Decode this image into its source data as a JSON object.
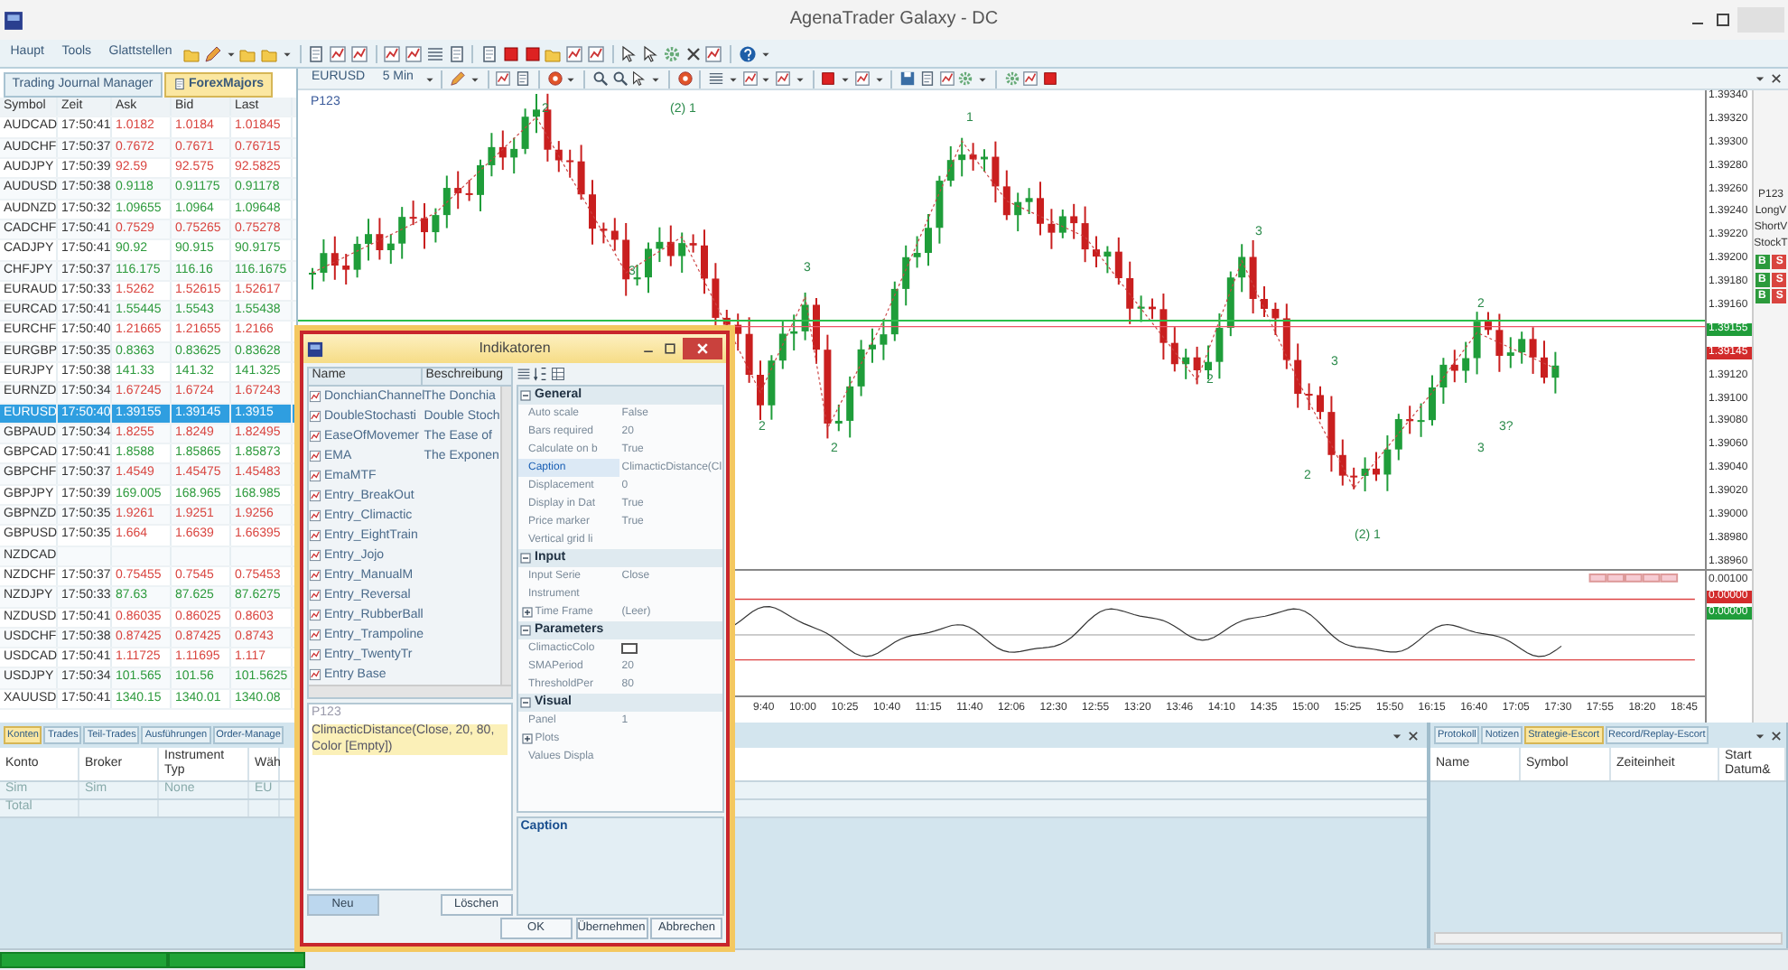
{
  "window": {
    "title": "AgenaTrader Galaxy - DC"
  },
  "menu": [
    {
      "label": "Haupt"
    },
    {
      "label": "Tools"
    },
    {
      "label": "Glattstellen"
    }
  ],
  "watchlist": {
    "tabs": [
      {
        "label": "Trading Journal Manager",
        "selected": false
      },
      {
        "label": "ForexMajors",
        "selected": true
      }
    ],
    "columns": [
      "Symbol",
      "Zeit",
      "Ask",
      "Bid",
      "Last"
    ],
    "rows": [
      {
        "symbol": "AUDCAD",
        "time": "17:50:41",
        "ask": "1.0182",
        "bid": "1.0184",
        "last": "1.01845",
        "color": "#d9443f",
        "selected": false
      },
      {
        "symbol": "AUDCHF",
        "time": "17:50:37",
        "ask": "0.7672",
        "bid": "0.7671",
        "last": "0.76715",
        "color": "#d9443f",
        "selected": false
      },
      {
        "symbol": "AUDJPY",
        "time": "17:50:39",
        "ask": "92.59",
        "bid": "92.575",
        "last": "92.5825",
        "color": "#d9443f",
        "selected": false
      },
      {
        "symbol": "AUDUSD",
        "time": "17:50:38",
        "ask": "0.9118",
        "bid": "0.91175",
        "last": "0.91178",
        "color": "#2c9a3c",
        "selected": false
      },
      {
        "symbol": "AUDNZD",
        "time": "17:50:32",
        "ask": "1.09655",
        "bid": "1.0964",
        "last": "1.09648",
        "color": "#2c9a3c",
        "selected": false
      },
      {
        "symbol": "CADCHF",
        "time": "17:50:41",
        "ask": "0.7529",
        "bid": "0.75265",
        "last": "0.75278",
        "color": "#d9443f",
        "selected": false
      },
      {
        "symbol": "CADJPY",
        "time": "17:50:41",
        "ask": "90.92",
        "bid": "90.915",
        "last": "90.9175",
        "color": "#2c9a3c",
        "selected": false
      },
      {
        "symbol": "CHFJPY",
        "time": "17:50:37",
        "ask": "116.175",
        "bid": "116.16",
        "last": "116.1675",
        "color": "#2c9a3c",
        "selected": false
      },
      {
        "symbol": "EURAUD",
        "time": "17:50:33",
        "ask": "1.5262",
        "bid": "1.52615",
        "last": "1.52617",
        "color": "#d9443f",
        "selected": false
      },
      {
        "symbol": "EURCAD",
        "time": "17:50:41",
        "ask": "1.55445",
        "bid": "1.5543",
        "last": "1.55438",
        "color": "#2c9a3c",
        "selected": false
      },
      {
        "symbol": "EURCHF",
        "time": "17:50:40",
        "ask": "1.21665",
        "bid": "1.21655",
        "last": "1.2166",
        "color": "#d9443f",
        "selected": false
      },
      {
        "symbol": "EURGBP",
        "time": "17:50:35",
        "ask": "0.8363",
        "bid": "0.83625",
        "last": "0.83628",
        "color": "#2c9a3c",
        "selected": false
      },
      {
        "symbol": "EURJPY",
        "time": "17:50:38",
        "ask": "141.33",
        "bid": "141.32",
        "last": "141.325",
        "color": "#2c9a3c",
        "selected": false
      },
      {
        "symbol": "EURNZD",
        "time": "17:50:34",
        "ask": "1.67245",
        "bid": "1.6724",
        "last": "1.67243",
        "color": "#d9443f",
        "selected": false
      },
      {
        "symbol": "EURUSD",
        "time": "17:50:40",
        "ask": "1.39155",
        "bid": "1.39145",
        "last": "1.3915",
        "selected": true
      },
      {
        "symbol": "GBPAUD",
        "time": "17:50:34",
        "ask": "1.8255",
        "bid": "1.8249",
        "last": "1.82495",
        "color": "#d9443f",
        "selected": false
      },
      {
        "symbol": "GBPCAD",
        "time": "17:50:41",
        "ask": "1.8588",
        "bid": "1.85865",
        "last": "1.85873",
        "color": "#2c9a3c",
        "selected": false
      },
      {
        "symbol": "GBPCHF",
        "time": "17:50:37",
        "ask": "1.4549",
        "bid": "1.45475",
        "last": "1.45483",
        "color": "#d9443f",
        "selected": false
      },
      {
        "symbol": "GBPJPY",
        "time": "17:50:39",
        "ask": "169.005",
        "bid": "168.965",
        "last": "168.985",
        "color": "#2c9a3c",
        "selected": false
      },
      {
        "symbol": "GBPNZD",
        "time": "17:50:35",
        "ask": "1.9261",
        "bid": "1.9251",
        "last": "1.9256",
        "color": "#d9443f",
        "selected": false
      },
      {
        "symbol": "GBPUSD",
        "time": "17:50:35",
        "ask": "1.664",
        "bid": "1.6639",
        "last": "1.66395",
        "color": "#d9443f",
        "selected": false
      },
      {
        "symbol": "NZDCAD",
        "selected": false
      },
      {
        "symbol": "NZDCHF",
        "time": "17:50:37",
        "ask": "0.75455",
        "bid": "0.7545",
        "last": "0.75453",
        "color": "#d9443f",
        "selected": false
      },
      {
        "symbol": "NZDJPY",
        "time": "17:50:33",
        "ask": "87.63",
        "bid": "87.625",
        "last": "87.6275",
        "color": "#2c9a3c",
        "selected": false
      },
      {
        "symbol": "NZDUSD",
        "time": "17:50:41",
        "ask": "0.86035",
        "bid": "0.86025",
        "last": "0.8603",
        "color": "#d9443f",
        "selected": false
      },
      {
        "symbol": "USDCHF",
        "time": "17:50:38",
        "ask": "0.87425",
        "bid": "0.87425",
        "last": "0.8743",
        "color": "#d9443f",
        "selected": false
      },
      {
        "symbol": "USDCAD",
        "time": "17:50:41",
        "ask": "1.11725",
        "bid": "1.11695",
        "last": "1.117",
        "color": "#d9443f",
        "selected": false
      },
      {
        "symbol": "USDJPY",
        "time": "17:50:34",
        "ask": "101.565",
        "bid": "101.56",
        "last": "101.5625",
        "color": "#2c9a3c",
        "selected": false
      },
      {
        "symbol": "XAUUSD",
        "time": "17:50:41",
        "ask": "1340.15",
        "bid": "1340.01",
        "last": "1340.08",
        "color": "#2c9a3c",
        "selected": false
      }
    ]
  },
  "chart": {
    "symbol": "EURUSD",
    "interval": "5 Min",
    "template": "P123",
    "wave_labels": [
      "2",
      "(2) 1",
      "3",
      "3",
      "2",
      "2",
      "1",
      "3",
      "2",
      "3",
      "2",
      "(2) 1",
      "2",
      "3?",
      "3"
    ],
    "price_labels": [
      {
        "text": "1.39340"
      },
      {
        "text": "1.39320"
      },
      {
        "text": "1.39300"
      },
      {
        "text": "1.39280"
      },
      {
        "text": "1.39260"
      },
      {
        "text": "1.39240"
      },
      {
        "text": "1.39220"
      },
      {
        "text": "1.39200"
      },
      {
        "text": "1.39180"
      },
      {
        "text": "1.39160"
      },
      {
        "text": "1.39155",
        "color": "#1f9d3a"
      },
      {
        "text": "1.39145",
        "color": "#d22b2b"
      },
      {
        "text": "1.39120"
      },
      {
        "text": "1.39100"
      },
      {
        "text": "1.39080"
      },
      {
        "text": "1.39060"
      },
      {
        "text": "1.39040"
      },
      {
        "text": "1.39020"
      },
      {
        "text": "1.39000"
      },
      {
        "text": "1.38980"
      },
      {
        "text": "1.38960"
      }
    ],
    "indicator_labels": [
      {
        "text": "0.00100"
      },
      {
        "text": "0.00000",
        "color": "#d22b2b"
      },
      {
        "text": "0.00000",
        "color": "#1f9d3a"
      }
    ],
    "time_labels": [
      "9:40",
      "10:00",
      "10:25",
      "10:40",
      "11:15",
      "11:40",
      "12:06",
      "12:30",
      "12:55",
      "13:20",
      "13:46",
      "14:10",
      "14:35",
      "15:00",
      "15:25",
      "15:50",
      "16:15",
      "16:40",
      "17:05",
      "17:30",
      "17:55",
      "18:20",
      "18:45"
    ],
    "side_panel": {
      "template": "P123",
      "labels": [
        "LongV",
        "ShortV",
        "StockT"
      ],
      "order_buttons": [
        {
          "buy": "B",
          "sell": "S"
        },
        {
          "buy": "B",
          "sell": "S"
        },
        {
          "buy": "B",
          "sell": "S"
        }
      ]
    }
  },
  "dialog": {
    "title": "Indikatoren",
    "list_columns": [
      "Name",
      "Beschreibung"
    ],
    "indicators": [
      {
        "name": "DonchianChannel",
        "description": "The Donchia"
      },
      {
        "name": "DoubleStochasti",
        "description": "Double Stoch"
      },
      {
        "name": "EaseOfMovemer",
        "description": "The Ease of"
      },
      {
        "name": "EMA",
        "description": "The Exponen"
      },
      {
        "name": "EmaMTF"
      },
      {
        "name": "Entry_BreakOut"
      },
      {
        "name": "Entry_Climactic"
      },
      {
        "name": "Entry_EightTrain"
      },
      {
        "name": "Entry_Jojo"
      },
      {
        "name": "Entry_ManualM"
      },
      {
        "name": "Entry_Reversal"
      },
      {
        "name": "Entry_RubberBall"
      },
      {
        "name": "Entry_Trampoline"
      },
      {
        "name": "Entry_TwentyTr"
      },
      {
        "name": "Entry Base"
      }
    ],
    "templates": [
      {
        "label": "P123",
        "selected": false
      },
      {
        "label": "ClimacticDistance(Close, 20, 80, Color [Empty])",
        "selected": true
      }
    ],
    "list_buttons": [
      {
        "label": "Neu",
        "focused": true
      },
      {
        "label": "Löschen",
        "focused": false
      }
    ],
    "categories": [
      {
        "name": "General",
        "expanded": true,
        "properties": [
          {
            "kind": "text",
            "name": "Auto scale",
            "value": "False",
            "selected": false
          },
          {
            "kind": "text",
            "name": "Bars required",
            "value": "20",
            "selected": false
          },
          {
            "kind": "text",
            "name": "Calculate on b",
            "value": "True",
            "selected": false
          },
          {
            "kind": "text",
            "name": "Caption",
            "value": "ClimacticDistance(Cl",
            "selected": true
          },
          {
            "kind": "text",
            "name": "Displacement",
            "value": "0",
            "selected": false
          },
          {
            "kind": "text",
            "name": "Display in Dat",
            "value": "True",
            "selected": false
          },
          {
            "kind": "text",
            "name": "Price marker",
            "value": "True",
            "selected": false
          },
          {
            "kind": "text",
            "name": "Vertical grid li",
            "selected": false
          }
        ]
      },
      {
        "name": "Input",
        "expanded": true,
        "properties": [
          {
            "kind": "text",
            "name": "Input Serie",
            "value": "Close",
            "selected": false
          },
          {
            "kind": "text",
            "name": "Instrument",
            "selected": false
          },
          {
            "kind": "group",
            "name": "Time Frame",
            "value": "(Leer)",
            "expanded": false,
            "selected": false
          }
        ]
      },
      {
        "name": "Parameters",
        "expanded": true,
        "properties": [
          {
            "kind": "swatch",
            "name": "ClimacticColo",
            "selected": false
          },
          {
            "kind": "text",
            "name": "SMAPeriod",
            "value": "20",
            "selected": false
          },
          {
            "kind": "text",
            "name": "ThresholdPer",
            "value": "80",
            "selected": false
          }
        ]
      },
      {
        "name": "Visual",
        "expanded": true,
        "properties": [
          {
            "kind": "text",
            "name": "Panel",
            "value": "1",
            "selected": false
          },
          {
            "kind": "group",
            "name": "Plots",
            "expanded": false,
            "selected": false
          },
          {
            "kind": "text",
            "name": "Values Displa",
            "selected": false
          }
        ]
      }
    ],
    "help_title": "Caption",
    "buttons": [
      "OK",
      "Übernehmen",
      "Abbrechen"
    ]
  },
  "accounts_panel": {
    "tabs": [
      {
        "label": "Konten",
        "selected": true
      },
      {
        "label": "Trades",
        "selected": false
      },
      {
        "label": "Teil-Trades",
        "selected": false
      },
      {
        "label": "Ausführungen",
        "selected": false
      },
      {
        "label": "Order-Manage",
        "selected": false
      }
    ],
    "columns": [
      "Konto",
      "Broker",
      "Instrument Typ",
      "Wäh"
    ],
    "rows": [
      [
        "Sim",
        "Sim",
        "None",
        "EU"
      ],
      [
        "Total"
      ]
    ]
  },
  "escort_panel": {
    "tabs": [
      {
        "label": "Protokoll",
        "selected": false
      },
      {
        "label": "Notizen",
        "selected": false
      },
      {
        "label": "Strategie-Escort",
        "selected": true
      },
      {
        "label": "Record/Replay-Escort",
        "selected": false
      }
    ],
    "columns": [
      "Name",
      "Symbol",
      "Zeiteinheit",
      "Start Datum&"
    ]
  }
}
